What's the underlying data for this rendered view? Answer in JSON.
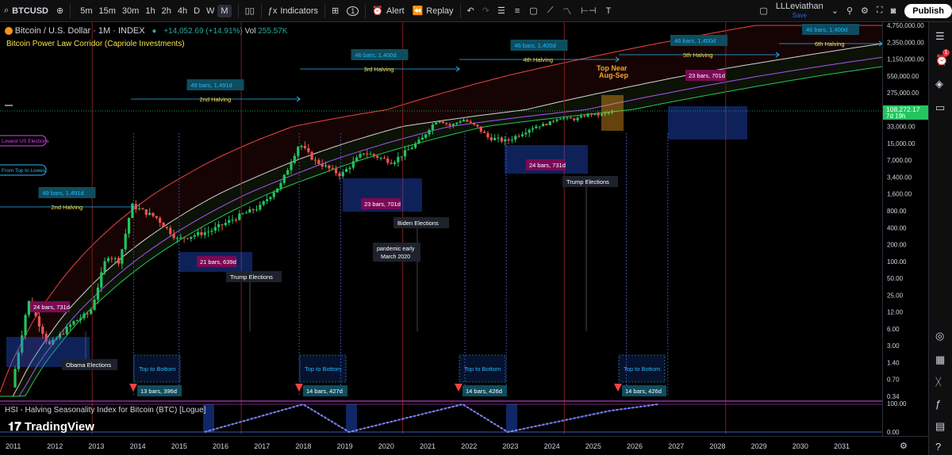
{
  "header": {
    "symbol": "BTCUSD",
    "timeframes": [
      "5m",
      "15m",
      "30m",
      "1h",
      "2h",
      "4h",
      "D",
      "W",
      "M"
    ],
    "active_timeframe": "M",
    "indicators_label": "Indicators",
    "alert_label": "Alert",
    "replay_label": "Replay",
    "user_name": "LLLeviathan",
    "save_label": "Save",
    "publish_label": "Publish",
    "layout_count": "1"
  },
  "legend": {
    "title": "Bitcoin / U.S. Dollar · 1M · INDEX",
    "change": "+14,052.69 (+14.91%)",
    "volume_label": "Vol",
    "volume_value": "255.57K",
    "indicator": "Bitcoin Power Law Corridor (Capriole Investments)",
    "subpane": "HSI - Halving Seasonality Index for Bitcoin (BTC) [Logue]"
  },
  "price_axis": [
    "4,750,000.00",
    "2,350,000.00",
    "1,150,000.00",
    "550,000.00",
    "275,000.00",
    "135,000.00",
    "33,000.00",
    "15,000.00",
    "7,000.00",
    "3,400.00",
    "1,600.00",
    "800.00",
    "400.00",
    "200.00",
    "100.00",
    "50.00",
    "25.00",
    "12.00",
    "6.00",
    "3.00",
    "1.40",
    "0.70",
    "0.34"
  ],
  "current_price": {
    "symbol": "BTCUSD",
    "value": "108,272.17",
    "countdown": "7d 19h"
  },
  "subpane_axis": [
    "100.00",
    "0.00"
  ],
  "time_axis": [
    "2011",
    "2012",
    "2013",
    "2014",
    "2015",
    "2016",
    "2017",
    "2018",
    "2019",
    "2020",
    "2021",
    "2022",
    "2023",
    "2024",
    "2025",
    "2026",
    "2027",
    "2028",
    "2029",
    "2030",
    "2031"
  ],
  "annotations": {
    "halvings": [
      {
        "bars": "49 bars, 1,491d",
        "label": "2nd Halving"
      },
      {
        "bars": "49 bars, 1,491d",
        "label": "2nd Halving"
      },
      {
        "bars": "46 bars, 1,400d",
        "label": "3rd Halving"
      },
      {
        "bars": "46 bars, 1,400d",
        "label": "4th Halving"
      },
      {
        "bars": "46 bars, 1,400d",
        "label": "5th Halving"
      },
      {
        "bars": "46 bars, 1,400d",
        "label": "6th Halving"
      }
    ],
    "elections": [
      "Obama Elections",
      "Trump Elections",
      "Biden Elections",
      "Trump Elections"
    ],
    "pandemic": [
      "pandemic early",
      "March 2020"
    ],
    "top_near": [
      "Top Near",
      "Aug-Sep"
    ],
    "range_labels": [
      "24 bars, 731d",
      "21 bars, 639d",
      "23 bars, 701d",
      "24 bars, 731d",
      "23 bars, 701d"
    ],
    "top_to_bottom": [
      "Top to Bottom",
      "Top to Bottom",
      "Top to Bottom",
      "Top to Bottom"
    ],
    "bottom_bars": [
      "13 bars, 396d",
      "14 bars, 427d",
      "14 bars, 426d",
      "14 bars, 426d"
    ],
    "left_tags": [
      "Lowest US Elections",
      "From Top to Lowest"
    ]
  },
  "logo": "TradingView",
  "colors": {
    "up": "#26a69a",
    "green_candle": "#22c55e",
    "down": "#ef5350",
    "accent": "#2962ff",
    "halving_text": "#f9e04b",
    "label_bg": "#7a0a55",
    "cyan": "#29b6f6"
  }
}
